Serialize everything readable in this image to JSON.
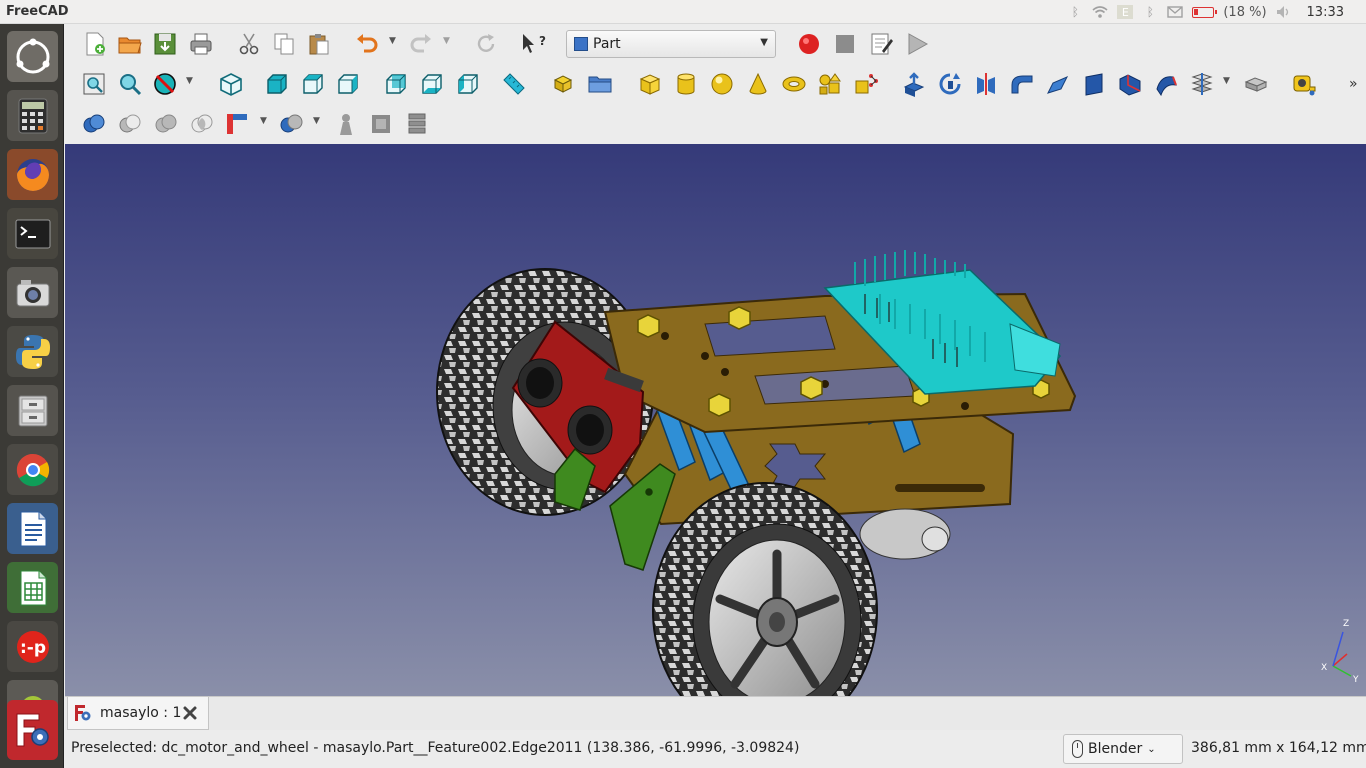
{
  "top_panel": {
    "app_title": "FreeCAD",
    "battery": "(18 %)",
    "clock": "13:33",
    "tray_icons": [
      "bluetooth-icon",
      "wifi-icon",
      "keyboard-E-icon",
      "bluetooth-icon",
      "mail-icon",
      "battery-icon",
      "volume-icon",
      "settings-icon"
    ]
  },
  "launcher": {
    "items": [
      "ubuntu-dash-icon",
      "calculator-icon",
      "firefox-icon",
      "terminal-icon",
      "screenshot-camera-icon",
      "python-icon",
      "file-cabinet-icon",
      "chrome-icon",
      "libreoffice-writer-icon",
      "libreoffice-calc-icon",
      "pidgin-icon",
      "android-icon",
      "freecad-icon"
    ]
  },
  "toolbar": {
    "workbench": "Part",
    "row1": [
      "new-file-icon",
      "open-file-icon",
      "save-icon",
      "print-icon",
      "cut-icon",
      "copy-icon",
      "paste-icon",
      "undo-icon",
      "redo-icon",
      "refresh-icon",
      "whats-this-icon",
      "record-macro-icon",
      "stop-macro-icon",
      "edit-macro-icon",
      "run-macro-icon"
    ],
    "row2": [
      "fit-all-icon",
      "fit-selection-icon",
      "draw-style-icon",
      "isometric-view-icon",
      "front-view-icon",
      "top-view-icon",
      "right-view-icon",
      "rear-view-icon",
      "bottom-view-icon",
      "left-view-icon",
      "measure-distance-icon",
      "create-part-icon",
      "create-group-icon",
      "box-icon",
      "cylinder-icon",
      "sphere-icon",
      "cone-icon",
      "torus-icon",
      "create-tube-icon",
      "primitives-icon",
      "shape-builder-icon",
      "extrude-icon",
      "revolve-icon",
      "mirror-icon",
      "fillet-icon",
      "chamfer-icon",
      "make-face-icon",
      "ruled-surface-icon",
      "loft-icon",
      "sweep-icon",
      "section-icon",
      "cross-sections-icon",
      "offset-icon",
      "thickness-icon",
      "projection-icon",
      "more-icon"
    ],
    "row3": [
      "boolean-icon",
      "cut-boolean-icon",
      "fuse-icon",
      "common-icon",
      "join-features-icon",
      "split-features-icon",
      "check-geometry-icon",
      "defeaturing-icon",
      "attachment-icon"
    ]
  },
  "document_tab": {
    "label": "masaylo : 1"
  },
  "status_bar": {
    "message": "Preselected: dc_motor_and_wheel - masaylo.Part__Feature002.Edge2011 (138.386, -61.9996, -3.09824)",
    "navigation_style": "Blender",
    "dimensions": "386,81 mm x 164,12 mm"
  },
  "axis_cross": {
    "labels": [
      "X",
      "Y",
      "Z"
    ]
  },
  "colors": {
    "viewport_top": "#353a79",
    "viewport_bottom": "#8a8fa9",
    "chassis": "#8a6a1e",
    "standoff": "#2f8fd6",
    "sensor": "#a31a1a",
    "bracket": "#3f8a1f",
    "board": "#1ec9c9",
    "nut": "#e8d43a"
  }
}
